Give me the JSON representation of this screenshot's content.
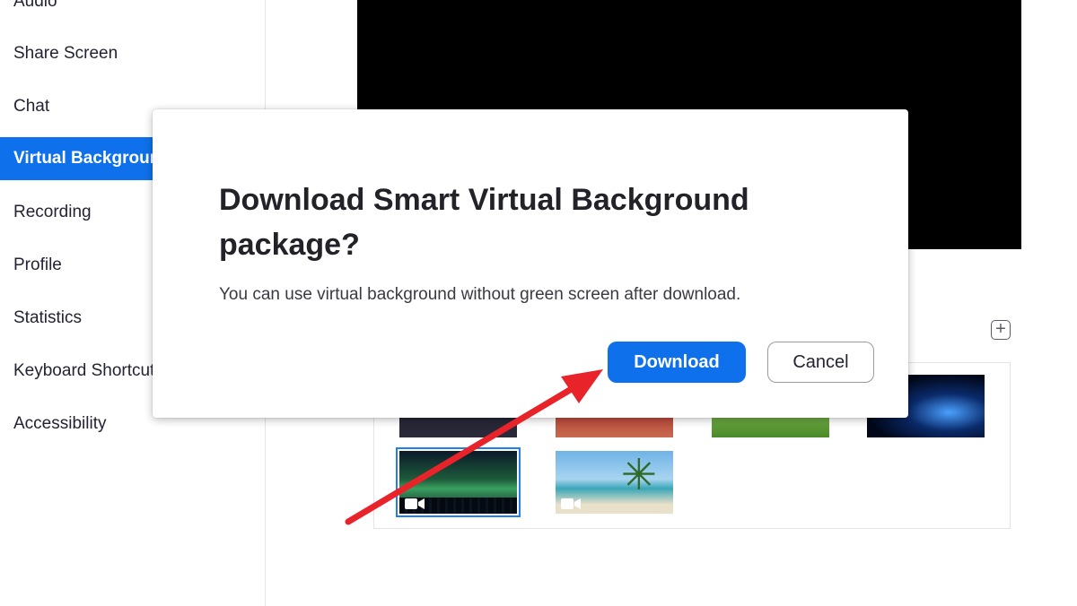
{
  "sidebar": {
    "items": [
      {
        "label": "Audio"
      },
      {
        "label": "Share Screen"
      },
      {
        "label": "Chat"
      },
      {
        "label": "Virtual Background",
        "active": true
      },
      {
        "label": "Recording"
      },
      {
        "label": "Profile"
      },
      {
        "label": "Statistics"
      },
      {
        "label": "Keyboard Shortcuts"
      },
      {
        "label": "Accessibility"
      }
    ]
  },
  "main": {
    "add_button_symbol": "+",
    "backgrounds": [
      {
        "name": "dark"
      },
      {
        "name": "bridge"
      },
      {
        "name": "grass"
      },
      {
        "name": "earth"
      },
      {
        "name": "aurora",
        "selected": true,
        "video": true
      },
      {
        "name": "beach",
        "video": true
      }
    ]
  },
  "dialog": {
    "title": "Download Smart Virtual Background package?",
    "message": "You can use virtual background without green screen after download.",
    "download_label": "Download",
    "cancel_label": "Cancel"
  },
  "colors": {
    "accent": "#0e71eb",
    "annotation_arrow": "#e8232a"
  },
  "icons": {
    "add": "plus-icon",
    "video": "video-camera-icon"
  }
}
